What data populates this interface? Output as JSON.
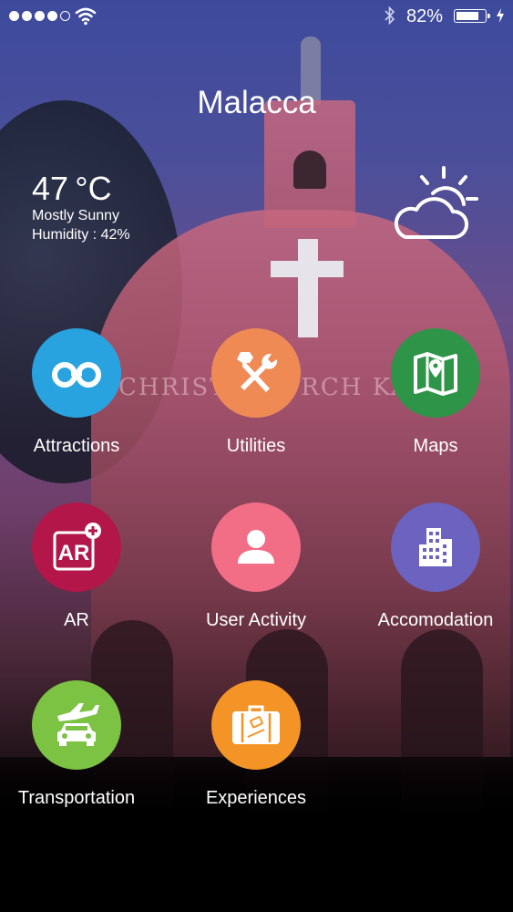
{
  "status_bar": {
    "battery_percent": "82%",
    "battery_level": 0.82
  },
  "city": "Malacca",
  "weather": {
    "temperature": "47",
    "unit": "°C",
    "condition": "Mostly Sunny",
    "humidity": "Humidity : 42%",
    "icon": "partly-cloudy-icon"
  },
  "background": {
    "sign_text": "CHRIST    CHURCH          KA"
  },
  "menu": [
    {
      "label": "Attractions",
      "color": "#29a3e0",
      "icon": "binoculars-icon"
    },
    {
      "label": "Utilities",
      "color": "#f08a55",
      "icon": "tools-icon"
    },
    {
      "label": "Maps",
      "color": "#2e9447",
      "icon": "map-icon"
    },
    {
      "label": "AR",
      "color": "#b3174a",
      "icon": "ar-icon"
    },
    {
      "label": "User Activity",
      "color": "#f26e86",
      "icon": "user-icon"
    },
    {
      "label": "Accomodation",
      "color": "#6b63bf",
      "icon": "building-icon"
    },
    {
      "label": "Transportation",
      "color": "#7cc243",
      "icon": "plane-car-icon"
    },
    {
      "label": "Experiences",
      "color": "#f59426",
      "icon": "suitcase-icon"
    }
  ]
}
